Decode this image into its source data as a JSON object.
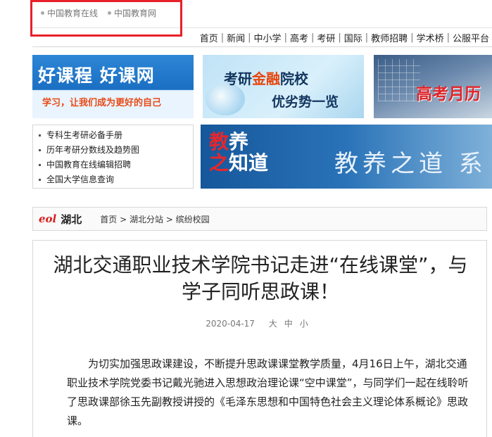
{
  "top_links": [
    "中国教育在线",
    "中国教育网"
  ],
  "nav": [
    "首页",
    "新闻",
    "中小学",
    "高考",
    "考研",
    "国际",
    "教师招聘",
    "学术桥",
    "公服平台"
  ],
  "banners": {
    "haokecheng": {
      "title": "好课程 好课网",
      "subtitle": "学习，让我们成为更好的自己"
    },
    "kaoyan": {
      "line1_a": "考研",
      "line1_b": "金融",
      "line1_c": "院校",
      "line2": "优劣势一览"
    },
    "gaokao": {
      "title": "高考月历"
    },
    "jiaoyang": {
      "logo_a": "教",
      "logo_b": "养",
      "logo_c": "之",
      "logo_d": "知道",
      "title": "教养之道 系"
    }
  },
  "quick_links": [
    "专科生考研必备手册",
    "历年考研分数线及趋势图",
    "中国教育在线编辑招聘",
    "全国大学信息查询"
  ],
  "location": {
    "logo": "eol",
    "region": "湖北",
    "breadcrumb": "首页 > 湖北分站 > 缤纷校园"
  },
  "article": {
    "title": "湖北交通职业技术学院书记走进“在线课堂”，与学子同听思政课！",
    "date": "2020-04-17",
    "font_sizes": "大中小",
    "body": "为切实加强思政课建设，不断提升思政课课堂教学质量，4月16日上午，湖北交通职业技术学院党委书记戴光驰进入思想政治理论课“空中课堂”，与同学们一起在线聆听了思政课部徐玉先副教授讲授的《毛泽东思想和中国特色社会主义理论体系概论》思政课。"
  }
}
